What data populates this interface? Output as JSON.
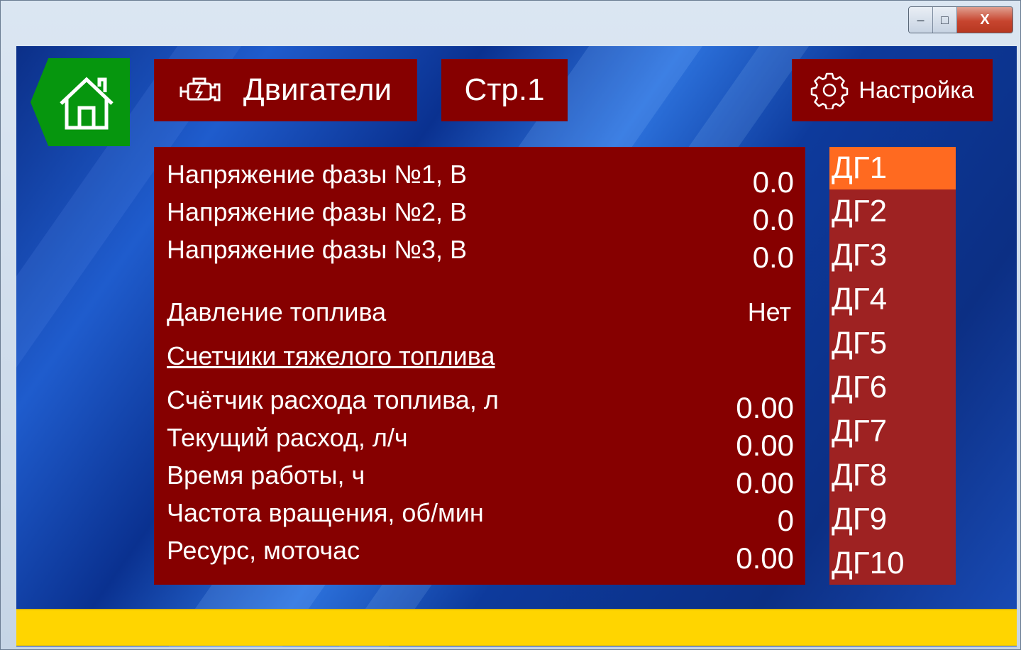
{
  "window": {
    "controls": {
      "minimize": "–",
      "maximize": "□",
      "close": "X"
    }
  },
  "header": {
    "home_icon": "home-icon",
    "engines_label": "Двигатели",
    "engines_icon": "engine-icon",
    "page_label": "Стр.1",
    "settings_label": "Настройка",
    "settings_icon": "gear-icon"
  },
  "panel": {
    "phases": [
      {
        "label": "Напряжение фазы №1, В",
        "value": "0.0"
      },
      {
        "label": "Напряжение фазы №2, В",
        "value": "0.0"
      },
      {
        "label": "Напряжение фазы №3, В",
        "value": "0.0"
      }
    ],
    "fuel_pressure": {
      "label": "Давление топлива",
      "value": "Нет"
    },
    "section_title": "Счетчики тяжелого топлива",
    "counters": [
      {
        "label": "Счётчик расхода топлива, л",
        "value": "0.00"
      },
      {
        "label": "Текущий расход, л/ч",
        "value": "0.00"
      },
      {
        "label": "Время работы, ч",
        "value": "0.00"
      },
      {
        "label": "Частота вращения, об/мин",
        "value": "0"
      },
      {
        "label": "Ресурс, моточас",
        "value": "0.00"
      }
    ]
  },
  "generators": {
    "items": [
      "ДГ1",
      "ДГ2",
      "ДГ3",
      "ДГ4",
      "ДГ5",
      "ДГ6",
      "ДГ7",
      "ДГ8",
      "ДГ9",
      "ДГ10"
    ],
    "selected": "ДГ1"
  },
  "colors": {
    "button_bg": "#860000",
    "home_bg": "#06960e",
    "selected_item": "#ff6a20",
    "list_bg": "#9e2222",
    "status_bar": "#ffd500"
  }
}
